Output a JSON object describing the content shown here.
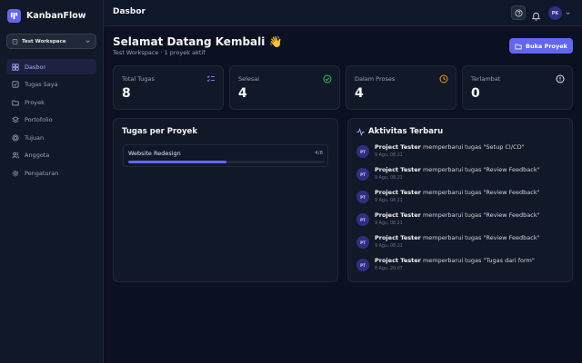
{
  "app": {
    "name": "KanbanFlow"
  },
  "workspace": {
    "name": "Test Workspace"
  },
  "nav": [
    {
      "label": "Dasbor",
      "icon": "grid-icon",
      "active": true
    },
    {
      "label": "Tugas Saya",
      "icon": "checkbox-icon"
    },
    {
      "label": "Proyek",
      "icon": "folder-icon"
    },
    {
      "label": "Portofolio",
      "icon": "layers-icon"
    },
    {
      "label": "Tujuan",
      "icon": "target-icon"
    },
    {
      "label": "Anggota",
      "icon": "users-icon"
    },
    {
      "label": "Pengaturan",
      "icon": "gear-icon"
    }
  ],
  "header": {
    "title": "Dasbor",
    "avatar_initials": "PK"
  },
  "welcome": {
    "title": "Selamat Datang Kembali 👋",
    "subtitle": "Test Workspace · 1 proyek aktif",
    "open_project_label": "Buka Proyek"
  },
  "stats": [
    {
      "label": "Total Tugas",
      "value": "8",
      "icon": "list-check-icon",
      "color": "#818cf8"
    },
    {
      "label": "Selesai",
      "value": "4",
      "icon": "check-circle-icon",
      "color": "#22c55e"
    },
    {
      "label": "Dalam Proses",
      "value": "4",
      "icon": "clock-icon",
      "color": "#f59e0b"
    },
    {
      "label": "Terlambat",
      "value": "0",
      "icon": "alert-circle-icon",
      "color": "#e5e7eb"
    }
  ],
  "projects_panel": {
    "title": "Tugas per Proyek",
    "items": [
      {
        "name": "Website Redesign",
        "count": "4/8",
        "progress": 0.5
      }
    ]
  },
  "activity_panel": {
    "title": "Aktivitas Terbaru",
    "items": [
      {
        "initials": "PT",
        "user": "Project Tester",
        "text": "memperbarui tugas \"Setup CI/CD\"",
        "time": "9 Agu, 08.21"
      },
      {
        "initials": "PT",
        "user": "Project Tester",
        "text": "memperbarui tugas \"Review Feedback\"",
        "time": "9 Agu, 08.21"
      },
      {
        "initials": "PT",
        "user": "Project Tester",
        "text": "memperbarui tugas \"Review Feedback\"",
        "time": "9 Agu, 08.21"
      },
      {
        "initials": "PT",
        "user": "Project Tester",
        "text": "memperbarui tugas \"Review Feedback\"",
        "time": "9 Agu, 08.21"
      },
      {
        "initials": "PT",
        "user": "Project Tester",
        "text": "memperbarui tugas \"Review Feedback\"",
        "time": "9 Agu, 08.21"
      },
      {
        "initials": "PT",
        "user": "Project Tester",
        "text": "memperbarui tugas \"Tugas dari form\"",
        "time": "8 Agu, 20.07"
      }
    ]
  }
}
